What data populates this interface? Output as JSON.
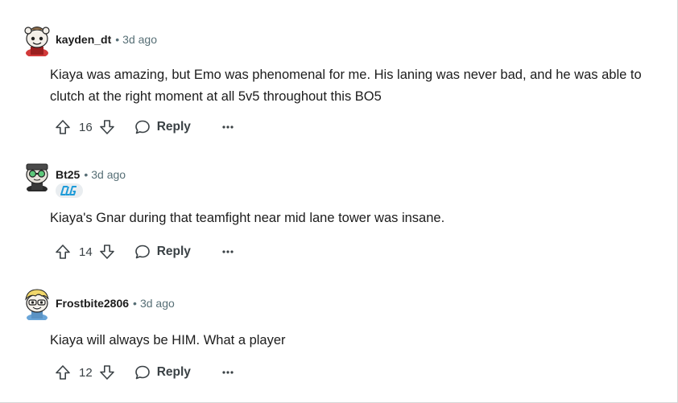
{
  "comments": [
    {
      "username": "kayden_dt",
      "separator": "•",
      "time": "3d ago",
      "text": "Kiaya was amazing, but Emo was phenomenal for me. His laning was never bad, and he was able to clutch at the right moment at all 5v5 throughout this BO5",
      "score": "16",
      "reply_label": "Reply",
      "avatar_icon": "snoo-avatar-red-hat"
    },
    {
      "username": "Bt25",
      "separator": "•",
      "time": "3d ago",
      "text": "Kiaya's Gnar during that teamfight near mid lane tower was insane.",
      "score": "14",
      "reply_label": "Reply",
      "avatar_icon": "snoo-avatar-goggles",
      "flair_icon": "clg-team-logo"
    },
    {
      "username": "Frostbite2806",
      "separator": "•",
      "time": "3d ago",
      "text": "Kiaya will always be HIM. What a player",
      "score": "12",
      "reply_label": "Reply",
      "avatar_icon": "snoo-avatar-blonde"
    }
  ],
  "colors": {
    "text": "#1c1c1c",
    "meta": "#576f76",
    "action": "#3a4145",
    "flair_bg": "#e9edf0",
    "flair_logo": "#1d9bd8"
  }
}
